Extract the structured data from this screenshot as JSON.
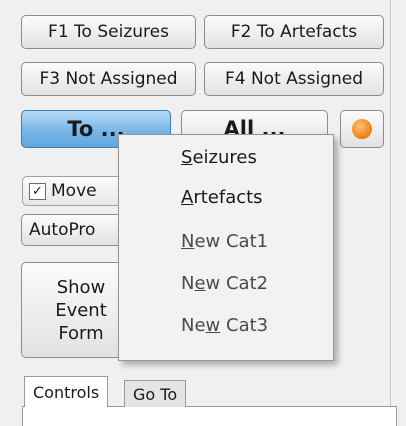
{
  "buttons": {
    "f1": "F1 To Seizures",
    "f2": "F2 To Artefacts",
    "f3": "F3 Not Assigned",
    "f4": "F4 Not Assigned",
    "to": "To ...",
    "all": "All ...",
    "autopro": "AutoPro",
    "show_lines": [
      "Show",
      "Event",
      "Form"
    ]
  },
  "checkbox": {
    "label": "Move",
    "checked": true,
    "check_glyph": "✓"
  },
  "menu": {
    "items": [
      {
        "pre": "",
        "ul": "S",
        "post": "eizures"
      },
      {
        "pre": "",
        "ul": "A",
        "post": "rtefacts"
      },
      {
        "pre": "",
        "ul": "N",
        "post": "ew Cat1"
      },
      {
        "pre": "N",
        "ul": "e",
        "post": "w Cat2"
      },
      {
        "pre": "Ne",
        "ul": "w",
        "post": " Cat3"
      }
    ]
  },
  "tabs": {
    "controls": "Controls",
    "goto": "Go To"
  },
  "icons": {
    "orange_button": "orange-circle-icon"
  }
}
